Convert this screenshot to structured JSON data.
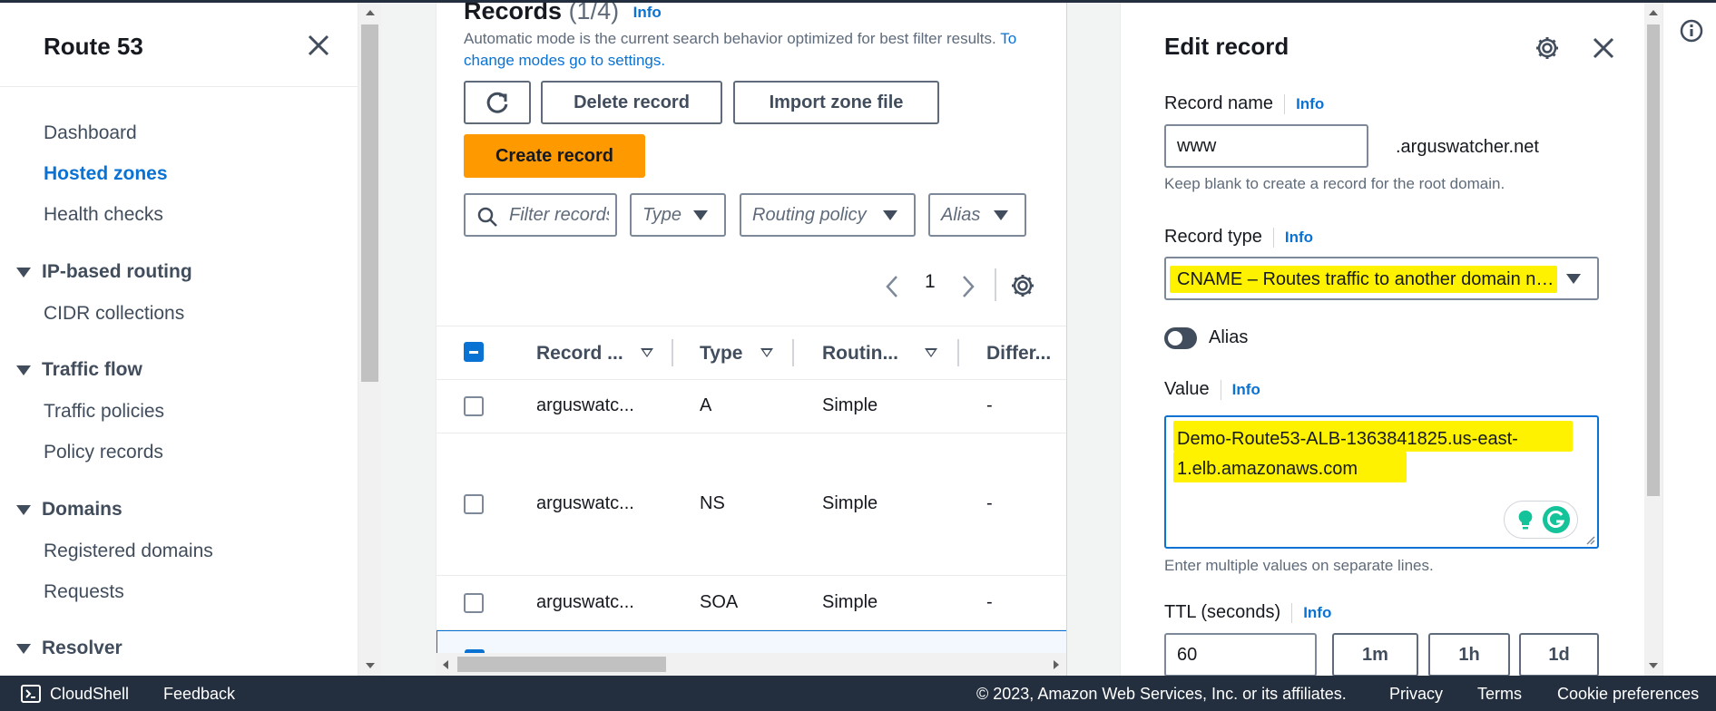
{
  "nav": {
    "title": "Route 53",
    "items": {
      "dashboard": "Dashboard",
      "hosted_zones": "Hosted zones",
      "health_checks": "Health checks",
      "cidr_collections": "CIDR collections",
      "traffic_policies": "Traffic policies",
      "policy_records": "Policy records",
      "registered_domains": "Registered domains",
      "requests": "Requests"
    },
    "sections": {
      "ip_routing": "IP-based routing",
      "traffic_flow": "Traffic flow",
      "domains": "Domains",
      "resolver": "Resolver"
    }
  },
  "records": {
    "title": "Records",
    "count": "(1/4)",
    "info": "Info",
    "description": "Automatic mode is the current search behavior optimized for best filter results.",
    "settings_link": "To change modes go to settings.",
    "delete_label": "Delete record",
    "import_label": "Import zone file",
    "create_label": "Create record",
    "filter_placeholder": "Filter records",
    "type_filter": "Type",
    "routing_filter": "Routing policy",
    "alias_filter": "Alias",
    "page": "1",
    "columns": [
      "Record ...",
      "Type",
      "Routin...",
      "Differ..."
    ],
    "rows": [
      {
        "name": "arguswatc...",
        "type": "A",
        "routing": "Simple",
        "diff": "-"
      },
      {
        "name": "arguswatc...",
        "type": "NS",
        "routing": "Simple",
        "diff": "-"
      },
      {
        "name": "arguswatc...",
        "type": "SOA",
        "routing": "Simple",
        "diff": "-"
      }
    ]
  },
  "edit": {
    "title": "Edit record",
    "record_name_label": "Record name",
    "record_name_value": "www",
    "domain_suffix": ".arguswatcher.net",
    "record_name_hint": "Keep blank to create a record for the root domain.",
    "record_type_label": "Record type",
    "record_type_value": "CNAME – Routes traffic to another domain name and to some AWS resources",
    "alias_label": "Alias",
    "value_label": "Value",
    "value_line1": "Demo-Route53-ALB-1363841825.us-east-",
    "value_line2": "1.elb.amazonaws.com",
    "value_hint": "Enter multiple values on separate lines.",
    "ttl_label": "TTL (seconds)",
    "ttl_value": "60",
    "ttl_buttons": [
      "1m",
      "1h",
      "1d"
    ],
    "info": "Info"
  },
  "footer": {
    "cloudshell": "CloudShell",
    "feedback": "Feedback",
    "copyright": "© 2023, Amazon Web Services, Inc. or its affiliates.",
    "privacy": "Privacy",
    "terms": "Terms",
    "cookies": "Cookie preferences"
  },
  "colors": {
    "accent": "#0972d3",
    "primary_button": "#ff9900",
    "highlight": "#fff200",
    "footer_bg": "#232f3e"
  }
}
